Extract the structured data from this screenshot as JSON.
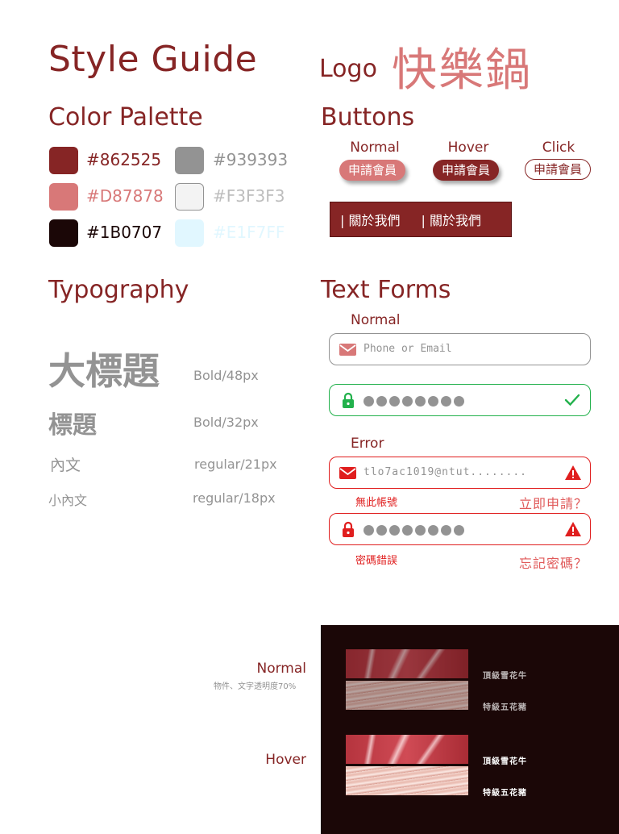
{
  "header": {
    "title": "Style Guide",
    "logo_label": "Logo",
    "logo_text": "快樂鍋"
  },
  "color_palette": {
    "heading": "Color Palette",
    "swatches": [
      {
        "hex": "#862525",
        "label": "#862525"
      },
      {
        "hex": "#939393",
        "label": "#939393"
      },
      {
        "hex": "#D87878",
        "label": "#D87878"
      },
      {
        "hex": "#F3F3F3",
        "label": "#F3F3F3"
      },
      {
        "hex": "#1B0707",
        "label": "#1B0707"
      },
      {
        "hex": "#E1F7FF",
        "label": "#E1F7FF"
      }
    ]
  },
  "buttons": {
    "heading": "Buttons",
    "states": {
      "normal": "Normal",
      "hover": "Hover",
      "click": "Click"
    },
    "pill_label": "申請會員",
    "nav_items": [
      "|  關於我們",
      "|  關於我們"
    ]
  },
  "typography": {
    "heading": "Typography",
    "samples": [
      {
        "text": "大標題",
        "spec": "Bold/48px"
      },
      {
        "text": "標題",
        "spec": "Bold/32px"
      },
      {
        "text": "內文",
        "spec": "regular/21px"
      },
      {
        "text": "小內文",
        "spec": "regular/18px"
      }
    ]
  },
  "text_forms": {
    "heading": "Text Forms",
    "normal_label": "Normal",
    "error_label": "Error",
    "email_placeholder": "Phone or Email",
    "error_email_value": "tlo7ac1019@ntut........",
    "error_account_msg": "無此帳號",
    "error_account_link": "立即申請？",
    "error_password_msg": "密碼錯誤",
    "error_password_link": "忘記密碼？",
    "password_dot_count": 8
  },
  "menu_cards": {
    "normal_label": "Normal",
    "normal_note": "物件、文字透明度70%",
    "hover_label": "Hover",
    "items": [
      "頂級雪花牛",
      "特級五花豬"
    ]
  },
  "colors": {
    "primary": "#862525",
    "gray": "#939393",
    "accent": "#D87878",
    "dark": "#1B0707",
    "light_gray": "#F3F3F3",
    "light_blue": "#E1F7FF",
    "success": "#22b14c",
    "error": "#e01e1e"
  }
}
